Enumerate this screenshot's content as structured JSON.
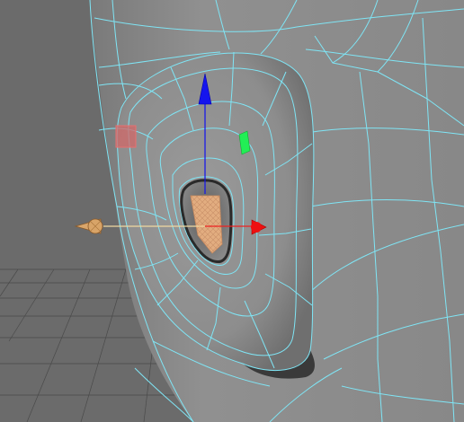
{
  "app": {
    "type": "3d-viewport",
    "view": "perspective"
  },
  "scene": {
    "object": "character-head-ear",
    "display": "wireframe-on-shaded",
    "wireframe_color": "#7fe5f5",
    "surface_color": "#8f8f8f",
    "background_color": "#6a6a6a",
    "ground_grid": true
  },
  "selection": {
    "type": "faces",
    "highlight_color": "#e7b07a"
  },
  "manipulator": {
    "type": "move-transform",
    "axes": [
      {
        "axis": "y",
        "color": "#1111ee"
      },
      {
        "axis": "x",
        "color": "#ee1111"
      },
      {
        "axis": "z",
        "color": "#d9a66b"
      }
    ],
    "plane_handles": [
      {
        "plane": "xz",
        "color": "#22ee55"
      },
      {
        "plane": "yz",
        "color": "#e87070"
      }
    ]
  }
}
